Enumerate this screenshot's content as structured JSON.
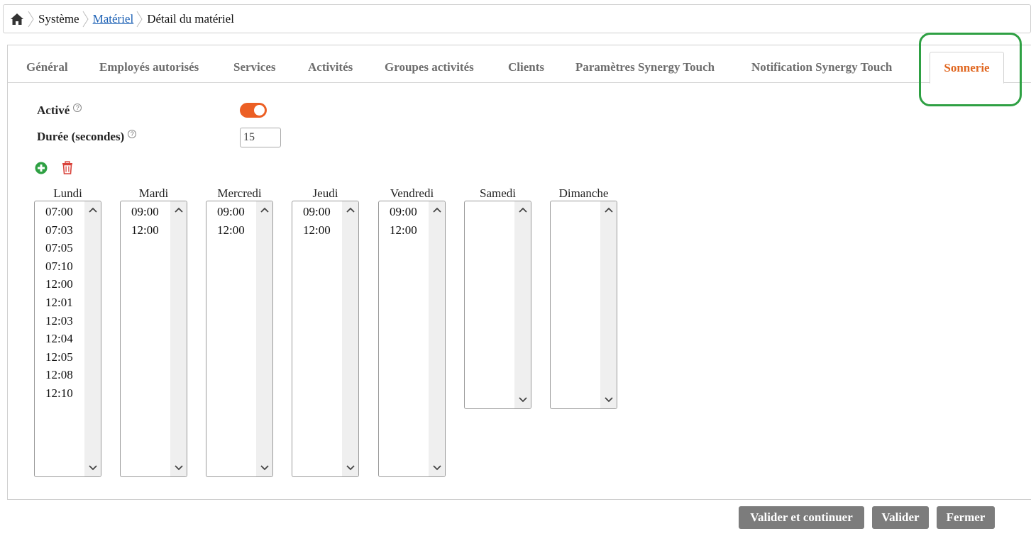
{
  "breadcrumb": {
    "items": [
      "Système",
      "Matériel",
      "Détail du matériel"
    ]
  },
  "tabs": [
    "Général",
    "Employés autorisés",
    "Services",
    "Activités",
    "Groupes activités",
    "Clients",
    "Paramètres Synergy Touch",
    "Notification Synergy Touch",
    "Sonnerie"
  ],
  "active_tab": "Sonnerie",
  "form": {
    "active_label": "Activé",
    "active_value": true,
    "duration_label": "Durée (secondes)",
    "duration_value": "15"
  },
  "colors": {
    "accent": "#ec5f24",
    "active_tab_text": "#e0661f",
    "highlight": "#2ea043",
    "add_icon": "#2ea043",
    "delete_icon": "#d9423a",
    "button_bg": "#7c7c7c"
  },
  "days": [
    {
      "name": "Lundi",
      "times": [
        "07:00",
        "07:03",
        "07:05",
        "07:10",
        "12:00",
        "12:01",
        "12:03",
        "12:04",
        "12:05",
        "12:08",
        "12:10"
      ]
    },
    {
      "name": "Mardi",
      "times": [
        "09:00",
        "12:00"
      ]
    },
    {
      "name": "Mercredi",
      "times": [
        "09:00",
        "12:00"
      ]
    },
    {
      "name": "Jeudi",
      "times": [
        "09:00",
        "12:00"
      ]
    },
    {
      "name": "Vendredi",
      "times": [
        "09:00",
        "12:00"
      ]
    },
    {
      "name": "Samedi",
      "times": []
    },
    {
      "name": "Dimanche",
      "times": []
    }
  ],
  "buttons": {
    "validate_continue": "Valider et continuer",
    "validate": "Valider",
    "close": "Fermer"
  }
}
